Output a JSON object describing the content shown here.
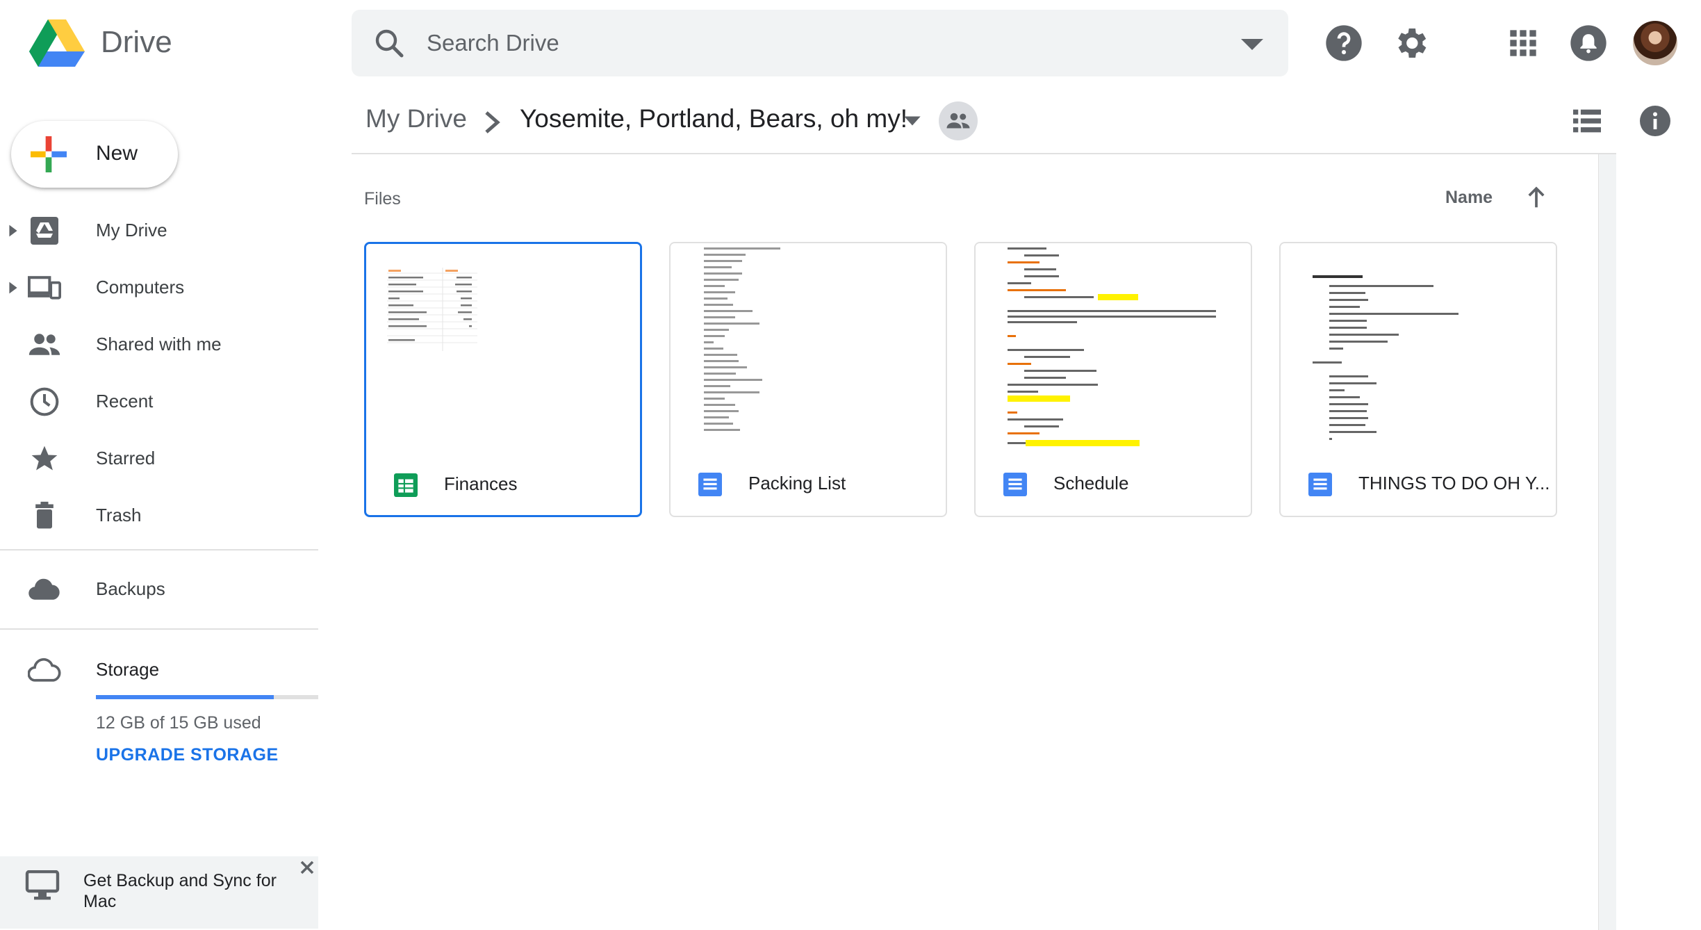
{
  "header": {
    "app_title": "Drive",
    "search_placeholder": "Search Drive"
  },
  "breadcrumb": {
    "root": "My Drive",
    "current": "Yosemite, Portland, Bears, oh my!"
  },
  "sidebar": {
    "new_label": "New",
    "items": [
      {
        "label": "My Drive",
        "icon": "drive-icon",
        "expandable": true
      },
      {
        "label": "Computers",
        "icon": "computers-icon",
        "expandable": true
      },
      {
        "label": "Shared with me",
        "icon": "people-icon",
        "expandable": false
      },
      {
        "label": "Recent",
        "icon": "clock-icon",
        "expandable": false
      },
      {
        "label": "Starred",
        "icon": "star-icon",
        "expandable": false
      },
      {
        "label": "Trash",
        "icon": "trash-icon",
        "expandable": false
      }
    ],
    "backups_label": "Backups",
    "storage": {
      "label": "Storage",
      "used_text": "12 GB of 15 GB used",
      "used_fraction": 0.8,
      "upgrade_label": "UPGRADE STORAGE"
    },
    "promo_text": "Get Backup and Sync for Mac"
  },
  "main": {
    "files_label": "Files",
    "sort_label": "Name",
    "files": [
      {
        "name": "Finances",
        "type": "sheets",
        "selected": true
      },
      {
        "name": "Packing List",
        "type": "docs",
        "selected": false
      },
      {
        "name": "Schedule",
        "type": "docs",
        "selected": false
      },
      {
        "name": "THINGS TO DO OH Y...",
        "type": "docs",
        "selected": false
      }
    ]
  },
  "colors": {
    "accent": "#1a73e8",
    "sheets_green": "#0f9d58",
    "docs_blue": "#4285f4"
  }
}
